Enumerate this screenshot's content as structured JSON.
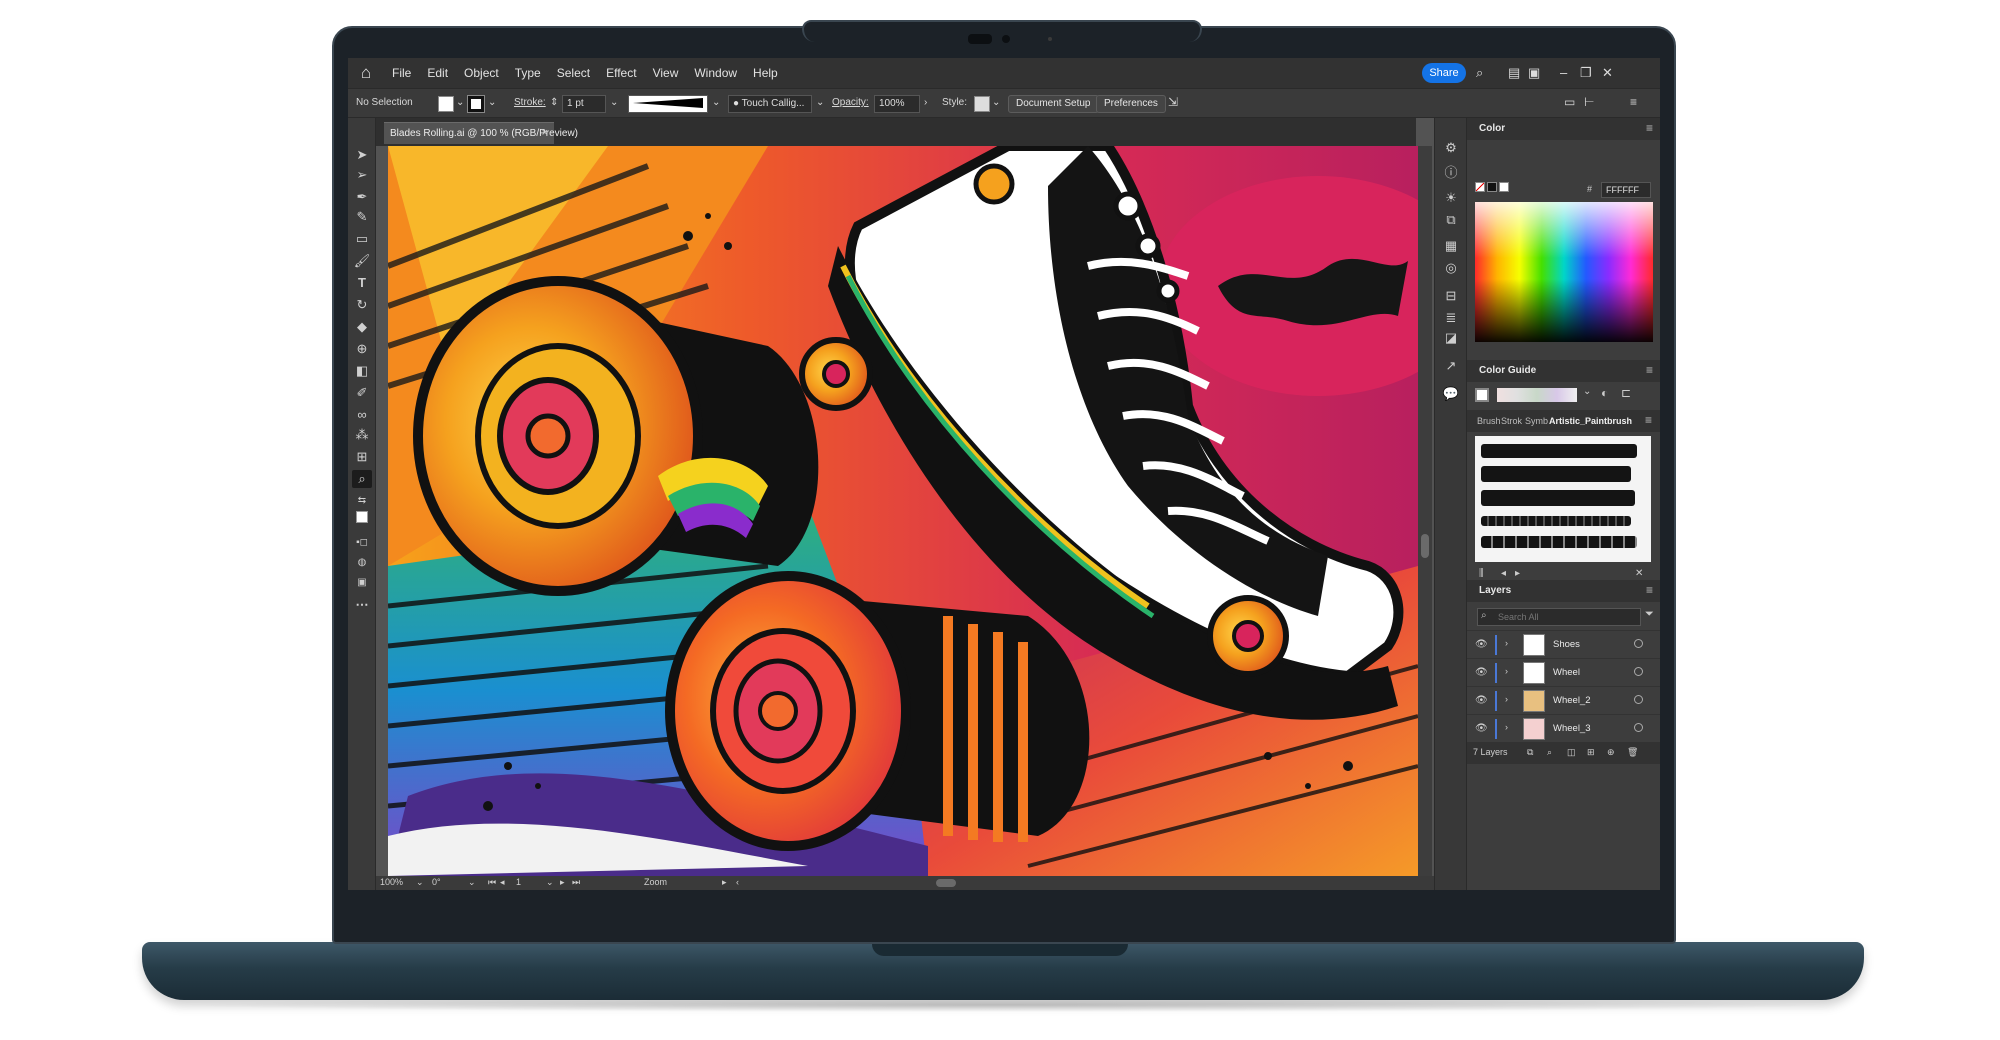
{
  "menubar": {
    "items": [
      "File",
      "Edit",
      "Object",
      "Type",
      "Select",
      "Effect",
      "View",
      "Window",
      "Help"
    ],
    "share_label": "Share"
  },
  "control_bar": {
    "selection_label": "No Selection",
    "stroke_label": "Stroke:",
    "stroke_weight": "1 pt",
    "brush_label": "Touch Callig...",
    "opacity_label": "Opacity:",
    "opacity_value": "100%",
    "style_label": "Style:",
    "document_setup_label": "Document Setup",
    "preferences_label": "Preferences"
  },
  "document": {
    "tab_title": "Blades Rolling.ai @ 100 % (RGB/Preview)",
    "tab_close": "×"
  },
  "status_bar": {
    "zoom": "100%",
    "rotation": "0°",
    "artboard": "1",
    "mode": "Zoom"
  },
  "color_panel": {
    "title": "Color",
    "hex_prefix": "#",
    "hex_value": "FFFFFF"
  },
  "color_guide_panel": {
    "title": "Color Guide"
  },
  "brush_panel": {
    "tabs": [
      "Brush",
      "Strok",
      "Symb",
      "Artistic_Paintbrush"
    ],
    "active_tab": "Artistic_Paintbrush"
  },
  "layers_panel": {
    "title": "Layers",
    "search_placeholder": "Search All",
    "layers": [
      {
        "name": "Shoes"
      },
      {
        "name": "Wheel"
      },
      {
        "name": "Wheel_2"
      },
      {
        "name": "Wheel_3"
      }
    ],
    "count_label": "7 Layers"
  },
  "colors": {
    "app_chrome": "#323232",
    "panel": "#3d3d3d",
    "canvas": "#535353",
    "accent": "#1473e6",
    "laptop_body": "#2b4350"
  }
}
